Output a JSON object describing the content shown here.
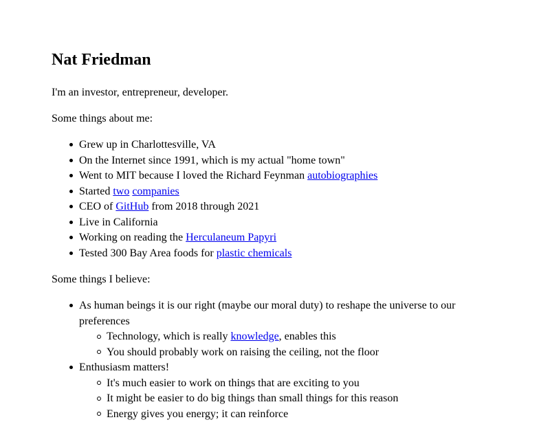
{
  "name": "Nat Friedman",
  "intro": "I'm an investor, entrepreneur, developer.",
  "about_heading": "Some things about me:",
  "about": [
    {
      "text": "Grew up in Charlottesville, VA"
    },
    {
      "text": "On the Internet since 1991, which is my actual \"home town\""
    },
    {
      "pre": "Went to MIT because I loved the Richard Feynman ",
      "link": "autobiographies"
    },
    {
      "pre": "Started ",
      "link1": "two",
      "mid": " ",
      "link2": "companies"
    },
    {
      "pre": "CEO of ",
      "link": "GitHub",
      "post": " from 2018 through 2021"
    },
    {
      "text": "Live in California"
    },
    {
      "pre": "Working on reading the ",
      "link": "Herculaneum Papyri"
    },
    {
      "pre": "Tested 300 Bay Area foods for ",
      "link": "plastic chemicals"
    }
  ],
  "beliefs_heading": "Some things I believe:",
  "beliefs": [
    {
      "text": "As human beings it is our right (maybe our moral duty) to reshape the universe to our preferences",
      "sub": [
        {
          "pre": "Technology, which is really ",
          "link": "knowledge",
          "post": ", enables this"
        },
        {
          "text": "You should probably work on raising the ceiling, not the floor"
        }
      ]
    },
    {
      "text": "Enthusiasm matters!",
      "sub": [
        {
          "text": "It's much easier to work on things that are exciting to you"
        },
        {
          "text": "It might be easier to do big things than small things for this reason"
        },
        {
          "text": "Energy gives you energy; it can reinforce"
        }
      ]
    }
  ]
}
